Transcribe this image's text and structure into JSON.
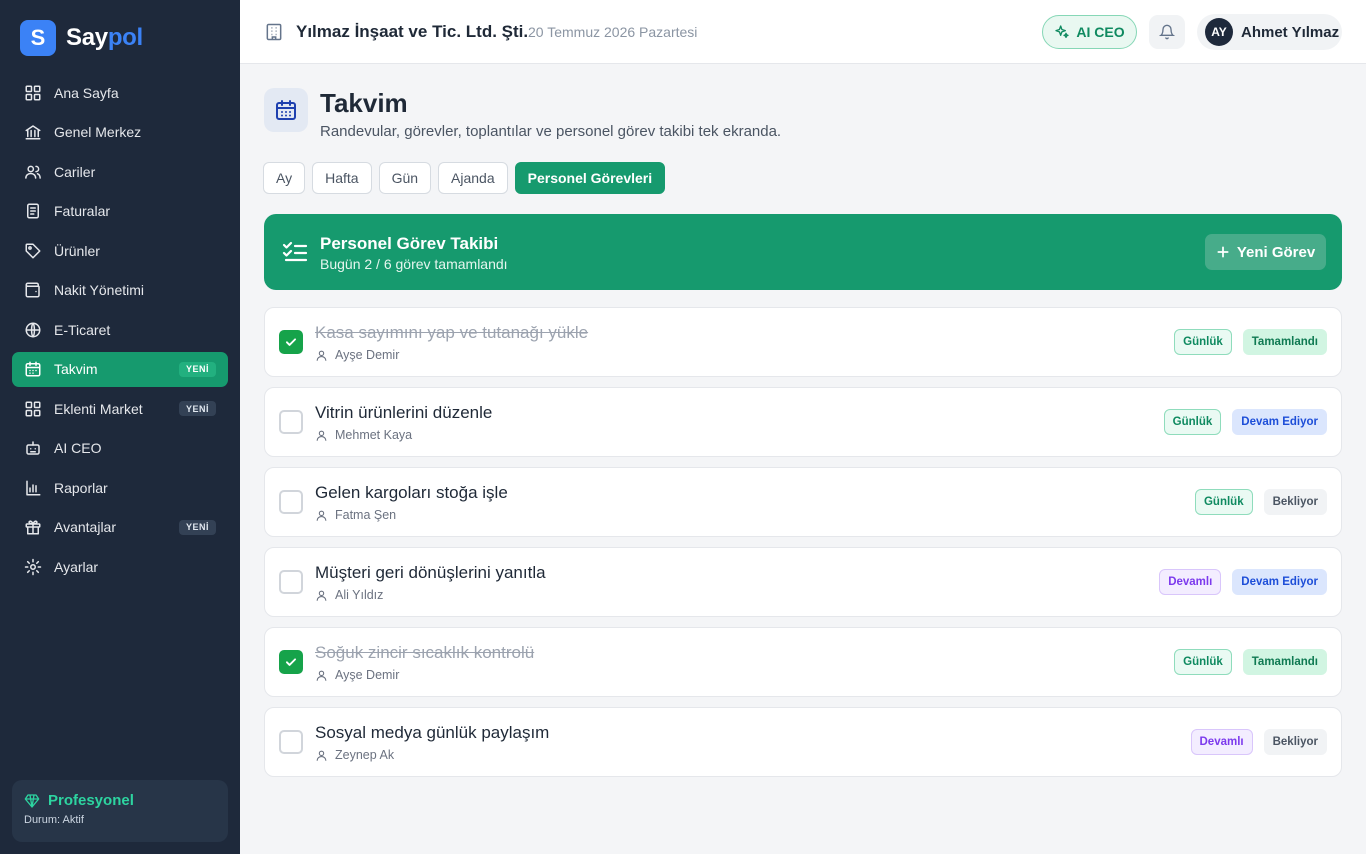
{
  "brand": {
    "logo_letter": "S",
    "name_part1": "Say",
    "name_part2": "pol",
    "accent": "#3b82f6"
  },
  "sidebar": {
    "items": [
      {
        "label": "Ana Sayfa",
        "icon": "grid-icon",
        "badge": ""
      },
      {
        "label": "Genel Merkez",
        "icon": "bank-icon",
        "badge": ""
      },
      {
        "label": "Cariler",
        "icon": "users-icon",
        "badge": ""
      },
      {
        "label": "Faturalar",
        "icon": "invoice-icon",
        "badge": ""
      },
      {
        "label": "Ürünler",
        "icon": "tag-icon",
        "badge": ""
      },
      {
        "label": "Nakit Yönetimi",
        "icon": "wallet-icon",
        "badge": ""
      },
      {
        "label": "E-Ticaret",
        "icon": "globe-icon",
        "badge": ""
      },
      {
        "label": "Takvim",
        "icon": "calendar-icon",
        "badge": "YENİ",
        "active": true
      },
      {
        "label": "Eklenti Market",
        "icon": "apps-icon",
        "badge": "YENİ"
      },
      {
        "label": "AI CEO",
        "icon": "robot-icon",
        "badge": ""
      },
      {
        "label": "Raporlar",
        "icon": "bar-chart-icon",
        "badge": ""
      },
      {
        "label": "Avantajlar",
        "icon": "gift-icon",
        "badge": "YENİ"
      },
      {
        "label": "Ayarlar",
        "icon": "gear-icon",
        "badge": ""
      }
    ],
    "plan": {
      "title": "Profesyonel",
      "status": "Durum: Aktif"
    }
  },
  "header": {
    "company": "Yılmaz İnşaat ve Tic. Ltd. Şti.",
    "date": "20 Temmuz 2026 Pazartesi",
    "ai_button": "AI CEO",
    "user_initials": "AY",
    "user_name": "Ahmet Yılmaz"
  },
  "page": {
    "title": "Takvim",
    "subtitle": "Randevular, görevler, toplantılar ve personel görev takibi tek ekranda."
  },
  "tabs": [
    {
      "label": "Ay"
    },
    {
      "label": "Hafta"
    },
    {
      "label": "Gün"
    },
    {
      "label": "Ajanda"
    },
    {
      "label": "Personel Görevleri",
      "active": true
    }
  ],
  "banner": {
    "title": "Personel Görev Takibi",
    "subtitle": "Bugün 2 / 6 görev tamamlandı",
    "button": "Yeni Görev",
    "color": "#169a6e"
  },
  "tasks": [
    {
      "title": "Kasa sayımını yap ve tutanağı yükle",
      "person": "Ayşe Demir",
      "frequency": "Günlük",
      "status": "Tamamlandı",
      "done": true
    },
    {
      "title": "Vitrin ürünlerini düzenle",
      "person": "Mehmet Kaya",
      "frequency": "Günlük",
      "status": "Devam Ediyor",
      "done": false
    },
    {
      "title": "Gelen kargoları stoğa işle",
      "person": "Fatma Şen",
      "frequency": "Günlük",
      "status": "Bekliyor",
      "done": false
    },
    {
      "title": "Müşteri geri dönüşlerini yanıtla",
      "person": "Ali Yıldız",
      "frequency": "Devamlı",
      "status": "Devam Ediyor",
      "done": false
    },
    {
      "title": "Soğuk zincir sıcaklık kontrolü",
      "person": "Ayşe Demir",
      "frequency": "Günlük",
      "status": "Tamamlandı",
      "done": true
    },
    {
      "title": "Sosyal medya günlük paylaşım",
      "person": "Zeynep Ak",
      "frequency": "Devamlı",
      "status": "Bekliyor",
      "done": false
    }
  ]
}
